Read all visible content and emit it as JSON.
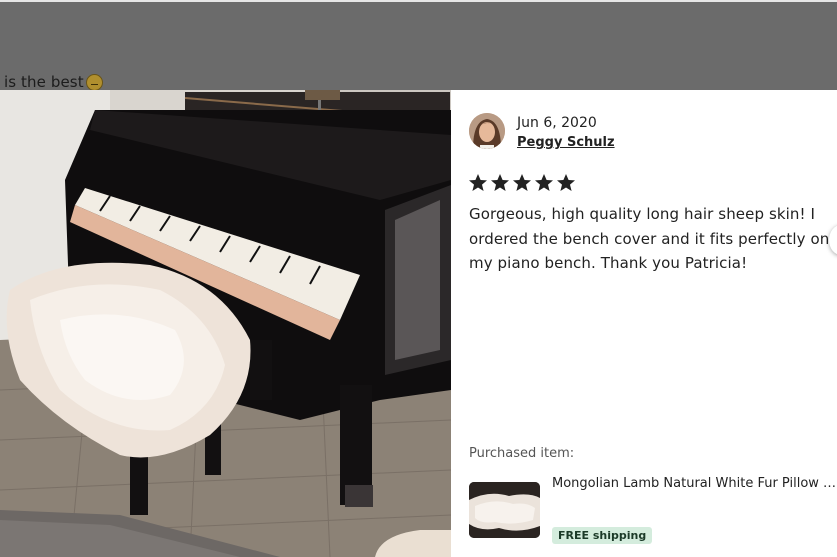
{
  "background": {
    "caption_text": "is the best",
    "emoji_icon": "grinning-face-emoji"
  },
  "review": {
    "date": "Jun 6, 2020",
    "reviewer_name": "Peggy Schulz",
    "rating": 5,
    "rating_max": 5,
    "text": "Gorgeous, high quality long hair sheep skin! I ordered the bench cover and it fits perfectly on my piano bench. Thank you Patricia!",
    "purchased_label": "Purchased item:",
    "product_title": "Mongolian Lamb Natural White Fur Pillow Bench Cover",
    "shipping_badge": "FREE shipping"
  },
  "icons": {
    "star": "star-icon",
    "next": "next-arrow-icon"
  },
  "colors": {
    "star": "#222222",
    "badge_bg": "#d4ecdd",
    "overlay": "#6b6b6b"
  }
}
